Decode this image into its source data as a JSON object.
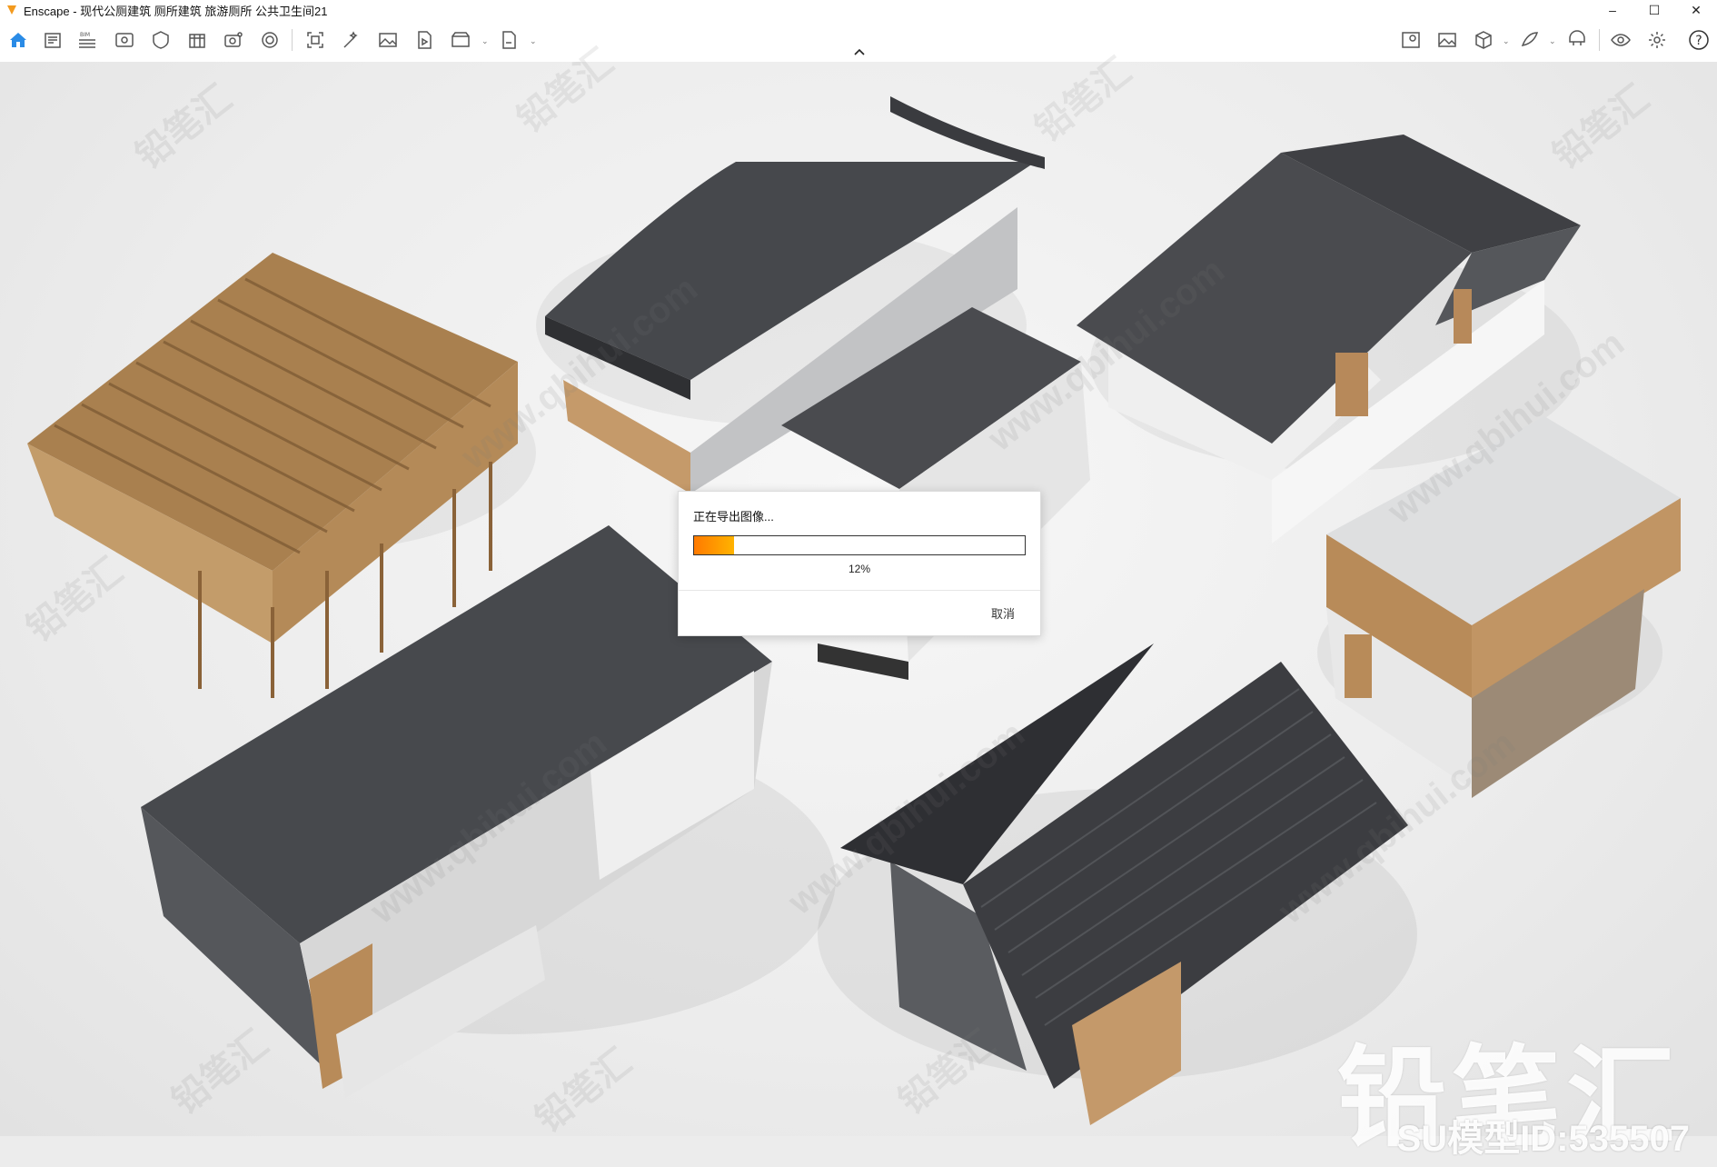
{
  "window": {
    "app_name": "Enscape",
    "title": "Enscape - 现代公厕建筑 厕所建筑 旅游厕所 公共卫生间21",
    "controls": [
      "–",
      "☐",
      "✕"
    ]
  },
  "toolbar": {
    "left_icons": [
      "home-icon",
      "document-icon",
      "bim-icon",
      "view-icon",
      "asset-library-icon",
      "material-icon",
      "capture-icon",
      "atmosphere-icon",
      "screenshot-icon",
      "batch-render-icon",
      "image-icon",
      "video-icon",
      "panorama-icon",
      "export-icon"
    ],
    "bim_label": "BIM",
    "right_icons": [
      "map-icon",
      "gallery-icon",
      "cube-icon",
      "vr-icon",
      "headset-icon",
      "eye-icon",
      "settings-icon",
      "help-icon"
    ],
    "help_label": "?"
  },
  "watermark": {
    "site": "www.qbihui.com",
    "brand_cn": "铅笔汇",
    "brand_large": "铅笔汇",
    "model_id": "SU模型ID:535507"
  },
  "dialog": {
    "title": "正在导出图像...",
    "progress_percent": 12,
    "progress_label": "12%",
    "cancel_label": "取消"
  },
  "colors": {
    "accent": "#f39a1e",
    "roof_dark": "#4b4c50",
    "wood": "#b98a5b",
    "wall_white": "#ececec"
  }
}
